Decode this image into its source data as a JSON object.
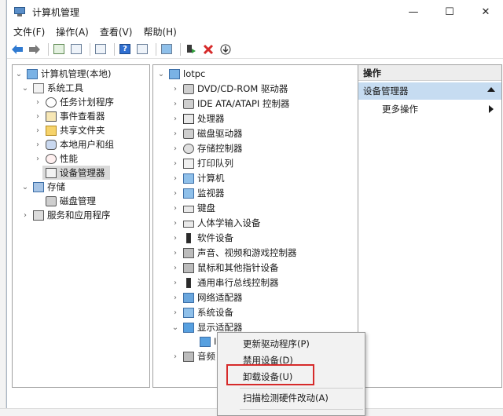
{
  "window": {
    "title": "计算机管理",
    "controls": {
      "minimize": "—",
      "maximize": "☐",
      "close": "✕"
    }
  },
  "menubar": {
    "items": [
      "文件(F)",
      "操作(A)",
      "查看(V)",
      "帮助(H)"
    ]
  },
  "toolbar": {
    "icons": [
      "back-arrow-icon",
      "forward-arrow-icon",
      "up-folder-icon",
      "show-hide-tree-icon",
      "properties-icon",
      "help-icon",
      "view-icon",
      "computer-icon",
      "update-driver-icon",
      "uninstall-x-icon",
      "download-icon"
    ]
  },
  "left_tree": {
    "root": "计算机管理(本地)",
    "system_tools": "系统工具",
    "system_tools_children": [
      "任务计划程序",
      "事件查看器",
      "共享文件夹",
      "本地用户和组",
      "性能",
      "设备管理器"
    ],
    "storage": "存储",
    "storage_children": [
      "磁盘管理"
    ],
    "services": "服务和应用程序"
  },
  "center_tree": {
    "root": "lotpc",
    "categories": [
      "DVD/CD-ROM 驱动器",
      "IDE ATA/ATAPI 控制器",
      "处理器",
      "磁盘驱动器",
      "存储控制器",
      "打印队列",
      "计算机",
      "监视器",
      "键盘",
      "人体学输入设备",
      "软件设备",
      "声音、视频和游戏控制器",
      "鼠标和其他指针设备",
      "通用串行总线控制器",
      "网络适配器",
      "系统设备",
      "显示适配器"
    ],
    "display_child_partial": "I",
    "last_partial": "音频"
  },
  "actions_pane": {
    "header": "操作",
    "section": "设备管理器",
    "more": "更多操作"
  },
  "context_menu": {
    "items": [
      "更新驱动程序(P)",
      "禁用设备(D)",
      "卸载设备(U)",
      "扫描检测硬件改动(A)"
    ],
    "highlighted": "卸载设备(U)",
    "highlight_color": "#d62a2a"
  }
}
